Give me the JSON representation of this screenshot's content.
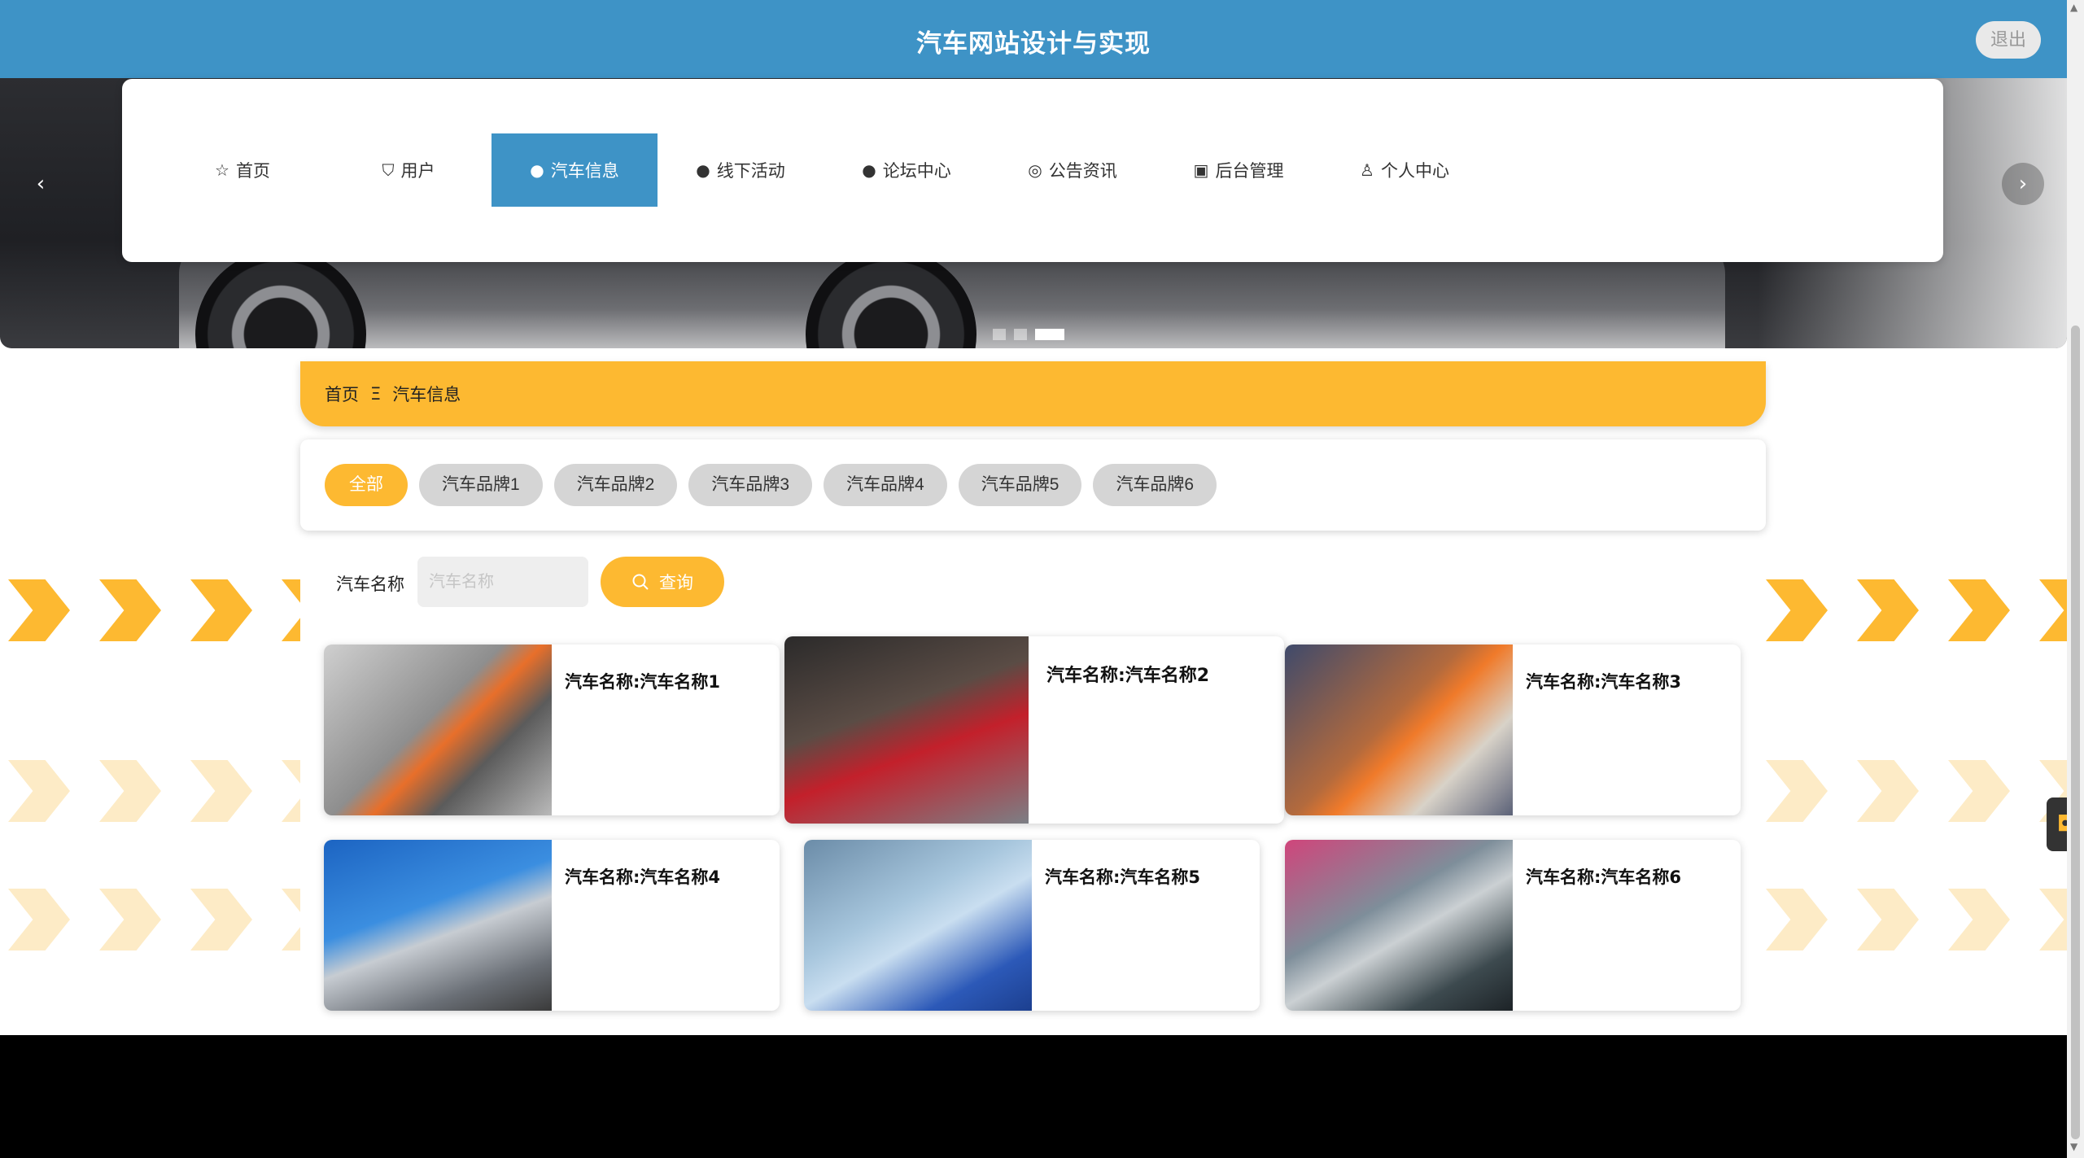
{
  "header": {
    "title": "汽车网站设计与实现",
    "logout_label": "退出"
  },
  "banner": {
    "prev_label": "‹",
    "next_label": "›",
    "slide_count": 3,
    "active_slide": 3
  },
  "nav": {
    "items": [
      {
        "label": "首页",
        "icon": "☆",
        "active": false
      },
      {
        "label": "用户",
        "icon": "⛉",
        "active": false
      },
      {
        "label": "汽车信息",
        "icon": "●",
        "active": true
      },
      {
        "label": "线下活动",
        "icon": "●",
        "active": false
      },
      {
        "label": "论坛中心",
        "icon": "●",
        "active": false
      },
      {
        "label": "公告资讯",
        "icon": "◎",
        "active": false
      },
      {
        "label": "后台管理",
        "icon": "▣",
        "active": false
      },
      {
        "label": "个人中心",
        "icon": "♙",
        "active": false
      }
    ]
  },
  "breadcrumb": {
    "home": "首页",
    "separator": "Ξ",
    "current": "汽车信息"
  },
  "filters": {
    "items": [
      "全部",
      "汽车品牌1",
      "汽车品牌2",
      "汽车品牌3",
      "汽车品牌4",
      "汽车品牌5",
      "汽车品牌6"
    ],
    "active_index": 0
  },
  "search": {
    "label": "汽车名称",
    "placeholder": "汽车名称",
    "button_label": "查询"
  },
  "cars": [
    {
      "name": "汽车名称:汽车名称1"
    },
    {
      "name": "汽车名称:汽车名称2"
    },
    {
      "name": "汽车名称:汽车名称3"
    },
    {
      "name": "汽车名称:汽车名称4"
    },
    {
      "name": "汽车名称:汽车名称5"
    },
    {
      "name": "汽车名称:汽车名称6"
    }
  ],
  "colors": {
    "primary": "#3e93c6",
    "accent": "#fdb931",
    "chip": "#d5d5d5"
  }
}
